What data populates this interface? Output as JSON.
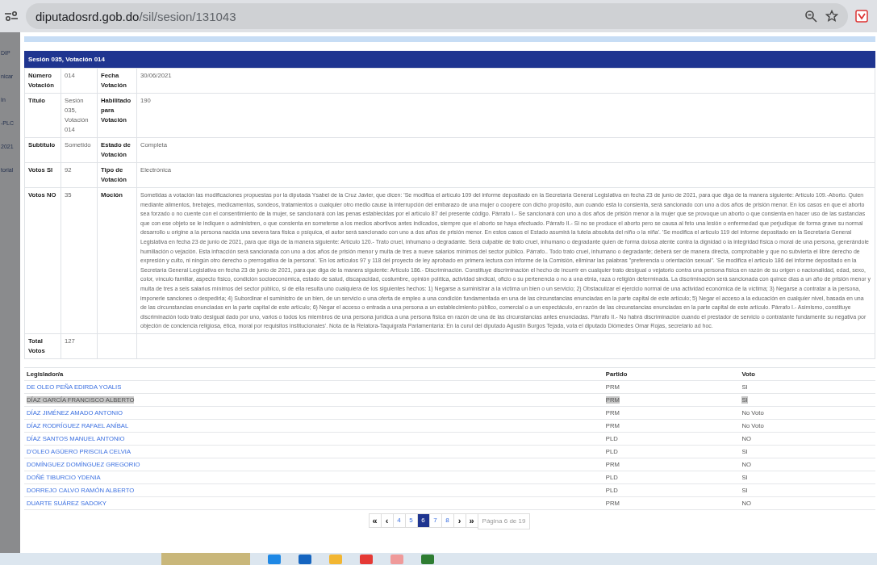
{
  "browser": {
    "url_host": "diputadosrd.gob.do",
    "url_path": "/sil/sesion/131043"
  },
  "background_fragments": [
    "DIP",
    "nicar",
    "In",
    "-PLC",
    "2021",
    "torial"
  ],
  "panel": {
    "title": "Sesión 035, Votación 014"
  },
  "details": [
    {
      "label": "Número Votación",
      "value": "014",
      "label2": "Fecha Votación",
      "value2": "30/06/2021"
    },
    {
      "label": "Título",
      "value": "Sesión 035, Votación 014",
      "label2": "Habilitado para Votación",
      "value2": "190"
    },
    {
      "label": "Subtítulo",
      "value": "Sometido",
      "label2": "Estado de Votación",
      "value2": "Completa"
    },
    {
      "label": "Votos SI",
      "value": "92",
      "label2": "Tipo de Votación",
      "value2": "Electrónica"
    },
    {
      "label": "Votos NO",
      "value": "35",
      "label2": "Moción",
      "value2": "Sometidas a votación las modificaciones propuestas por la diputada Ysabel de la Cruz Javier, que dicen: 'Se modifica el artículo 109 del informe depositado en la Secretaría General Legislativa en fecha 23 de junio de 2021, para que diga de la manera siguiente: Artículo 109.-Aborto. Quien mediante alimentos, brebajes, medicamentos, sondeos, tratamientos o cualquier otro medio cause la interrupción del embarazo de una mujer o coopere con dicho propósito, aun cuando esta lo consienta, será sancionado con uno a dos años de prisión menor. En los casos en que el aborto sea forzado o no cuente con el consentimiento de la mujer, se sancionará con las penas establecidas por el artículo 87 del presente código. Párrafo I.- Se sancionará con uno a dos años de prisión menor a la mujer que se provoque un aborto o que consienta en hacer uso de las sustancias que con ese objeto se le indiquen o administren, o que consienta en someterse a los medios abortivos antes indicados, siempre que el aborto se haya efectuado. Párrafo II.- Si no se produce el aborto pero se causa al feto una lesión o enfermedad que perjudique de forma grave su normal desarrollo u origine a la persona nacida una severa tara física o psíquica, el autor será sancionado con uno a dos años de prisión menor. En estos casos el Estado asumirá la tutela absoluta del niño o la niña'. 'Se modifica el artículo 119 del informe depositado en la Secretaría General Legislativa en fecha 23 de junio de 2021, para que diga de la manera siguiente: Artículo 120.- Trato cruel, inhumano o degradante. Será culpable de trato cruel, inhumano o degradante quien de forma dolosa atente contra la dignidad o la integridad física o moral de una persona, generándole humillación o vejación. Esta infracción será sancionada con uno a dos años de prisión menor y multa de tres a nueve salarios mínimos del sector público. Párrafo.. Todo trato cruel, inhumano o degradante; deberá ser de manera directa, comprobable y que no subvierta el libre derecho de expresión y culto, ni ningún otro derecho o prerrogativa de la persona'. 'En los artículos 97 y 118 del proyecto de ley aprobado en primera lectura con informe de la Comisión, eliminar las palabras \"preferencia u orientación sexual\". 'Se modifica el artículo 186 del informe depositado en la Secretaría General Legislativa en fecha 23 de junio de 2021, para que diga de la manera siguiente: Artículo 186.- Discriminación. Constituye discriminación el hecho de incurrir en cualquier trato desigual o vejatorio contra una persona física en razón de su origen o nacionalidad, edad, sexo, color, vínculo familiar, aspecto físico, condición socioeconómica, estado de salud, discapacidad, costumbre, opinión política, actividad sindical, oficio o su pertenencia o no a una etnia, raza o religión determinada. La discriminación será sancionada con quince días a un año de prisión menor y multa de tres a seis salarios mínimos del sector público, si de ella resulta uno cualquiera de los siguientes hechos: 1) Negarse a suministrar a la víctima un bien o un servicio; 2) Obstaculizar el ejercicio normal de una actividad económica de la víctima; 3) Negarse a contratar a la persona, imponerle sanciones o despedirla; 4) Subordinar el suministro de un bien, de un servicio o una oferta de empleo a una condición fundamentada en una de las circunstancias enunciadas en la parte capital de este artículo; 5) Negar el acceso a la educación en cualquier nivel, basada en una de las circunstancias enunciadas en la parte capital de este artículo; 6) Negar el acceso o entrada a una persona a un establecimiento público, comercial o a un espectáculo, en razón de las circunstancias enunciadas en la parte capital de este artículo. Párrafo I.- Asimismo, constituye discriminación todo trato desigual dado por uno, varios o todos los miembros de una persona jurídica a una persona física en razón de una de las circunstancias antes enunciadas. Párrafo II.- No habrá discriminación cuando el prestador de servicio o contratante fundamente su negativa por objeción de conciencia religiosa, ética, moral por requisitos institucionales'. Nota de la Relatora-Taquígrafa Parlamentaria: En la curul del diputado Agustín Burgos Tejada, vota el diputado Diómedes Omar Rojas, secretario ad hoc."
    },
    {
      "label": "Total Votos",
      "value": "127"
    }
  ],
  "votes": {
    "columns": [
      "Legislador/a",
      "Partido",
      "Voto"
    ],
    "rows": [
      {
        "name": "DE OLEO PEÑA EDIRDA YOALIS",
        "party": "PRM",
        "vote": "SI",
        "selected": false
      },
      {
        "name": "DÍAZ GARCÍA FRANCISCO ALBERTO",
        "party": "PRM",
        "vote": "SI",
        "selected": true
      },
      {
        "name": "DÍAZ JIMÉNEZ AMADO ANTONIO",
        "party": "PRM",
        "vote": "No Voto",
        "selected": false
      },
      {
        "name": "DÍAZ RODRÍGUEZ RAFAEL ANÍBAL",
        "party": "PRM",
        "vote": "No Voto",
        "selected": false
      },
      {
        "name": "DÍAZ SANTOS MANUEL ANTONIO",
        "party": "PLD",
        "vote": "NO",
        "selected": false
      },
      {
        "name": "D'OLEO AGÜERO PRISCILA CELVIA",
        "party": "PLD",
        "vote": "SI",
        "selected": false
      },
      {
        "name": "DOMÍNGUEZ DOMÍNGUEZ GREGORIO",
        "party": "PRM",
        "vote": "NO",
        "selected": false
      },
      {
        "name": "DOÑÉ TIBURCIO YDENIA",
        "party": "PLD",
        "vote": "SI",
        "selected": false
      },
      {
        "name": "DORREJO CALVO RAMÓN ALBERTO",
        "party": "PLD",
        "vote": "SI",
        "selected": false
      },
      {
        "name": "DUARTE SUÁREZ SADOKY",
        "party": "PRM",
        "vote": "NO",
        "selected": false
      }
    ]
  },
  "pagination": {
    "pages": [
      {
        "label": "«",
        "kind": "nav",
        "selected": false
      },
      {
        "label": "‹",
        "kind": "nav",
        "selected": false
      },
      {
        "label": "4",
        "kind": "page",
        "selected": false
      },
      {
        "label": "5",
        "kind": "page",
        "selected": false
      },
      {
        "label": "6",
        "kind": "page",
        "selected": true
      },
      {
        "label": "7",
        "kind": "page",
        "selected": false
      },
      {
        "label": "8",
        "kind": "page",
        "selected": false
      },
      {
        "label": "›",
        "kind": "nav",
        "selected": false
      },
      {
        "label": "»",
        "kind": "nav",
        "selected": false
      }
    ],
    "info": "Página 6 de 19"
  }
}
